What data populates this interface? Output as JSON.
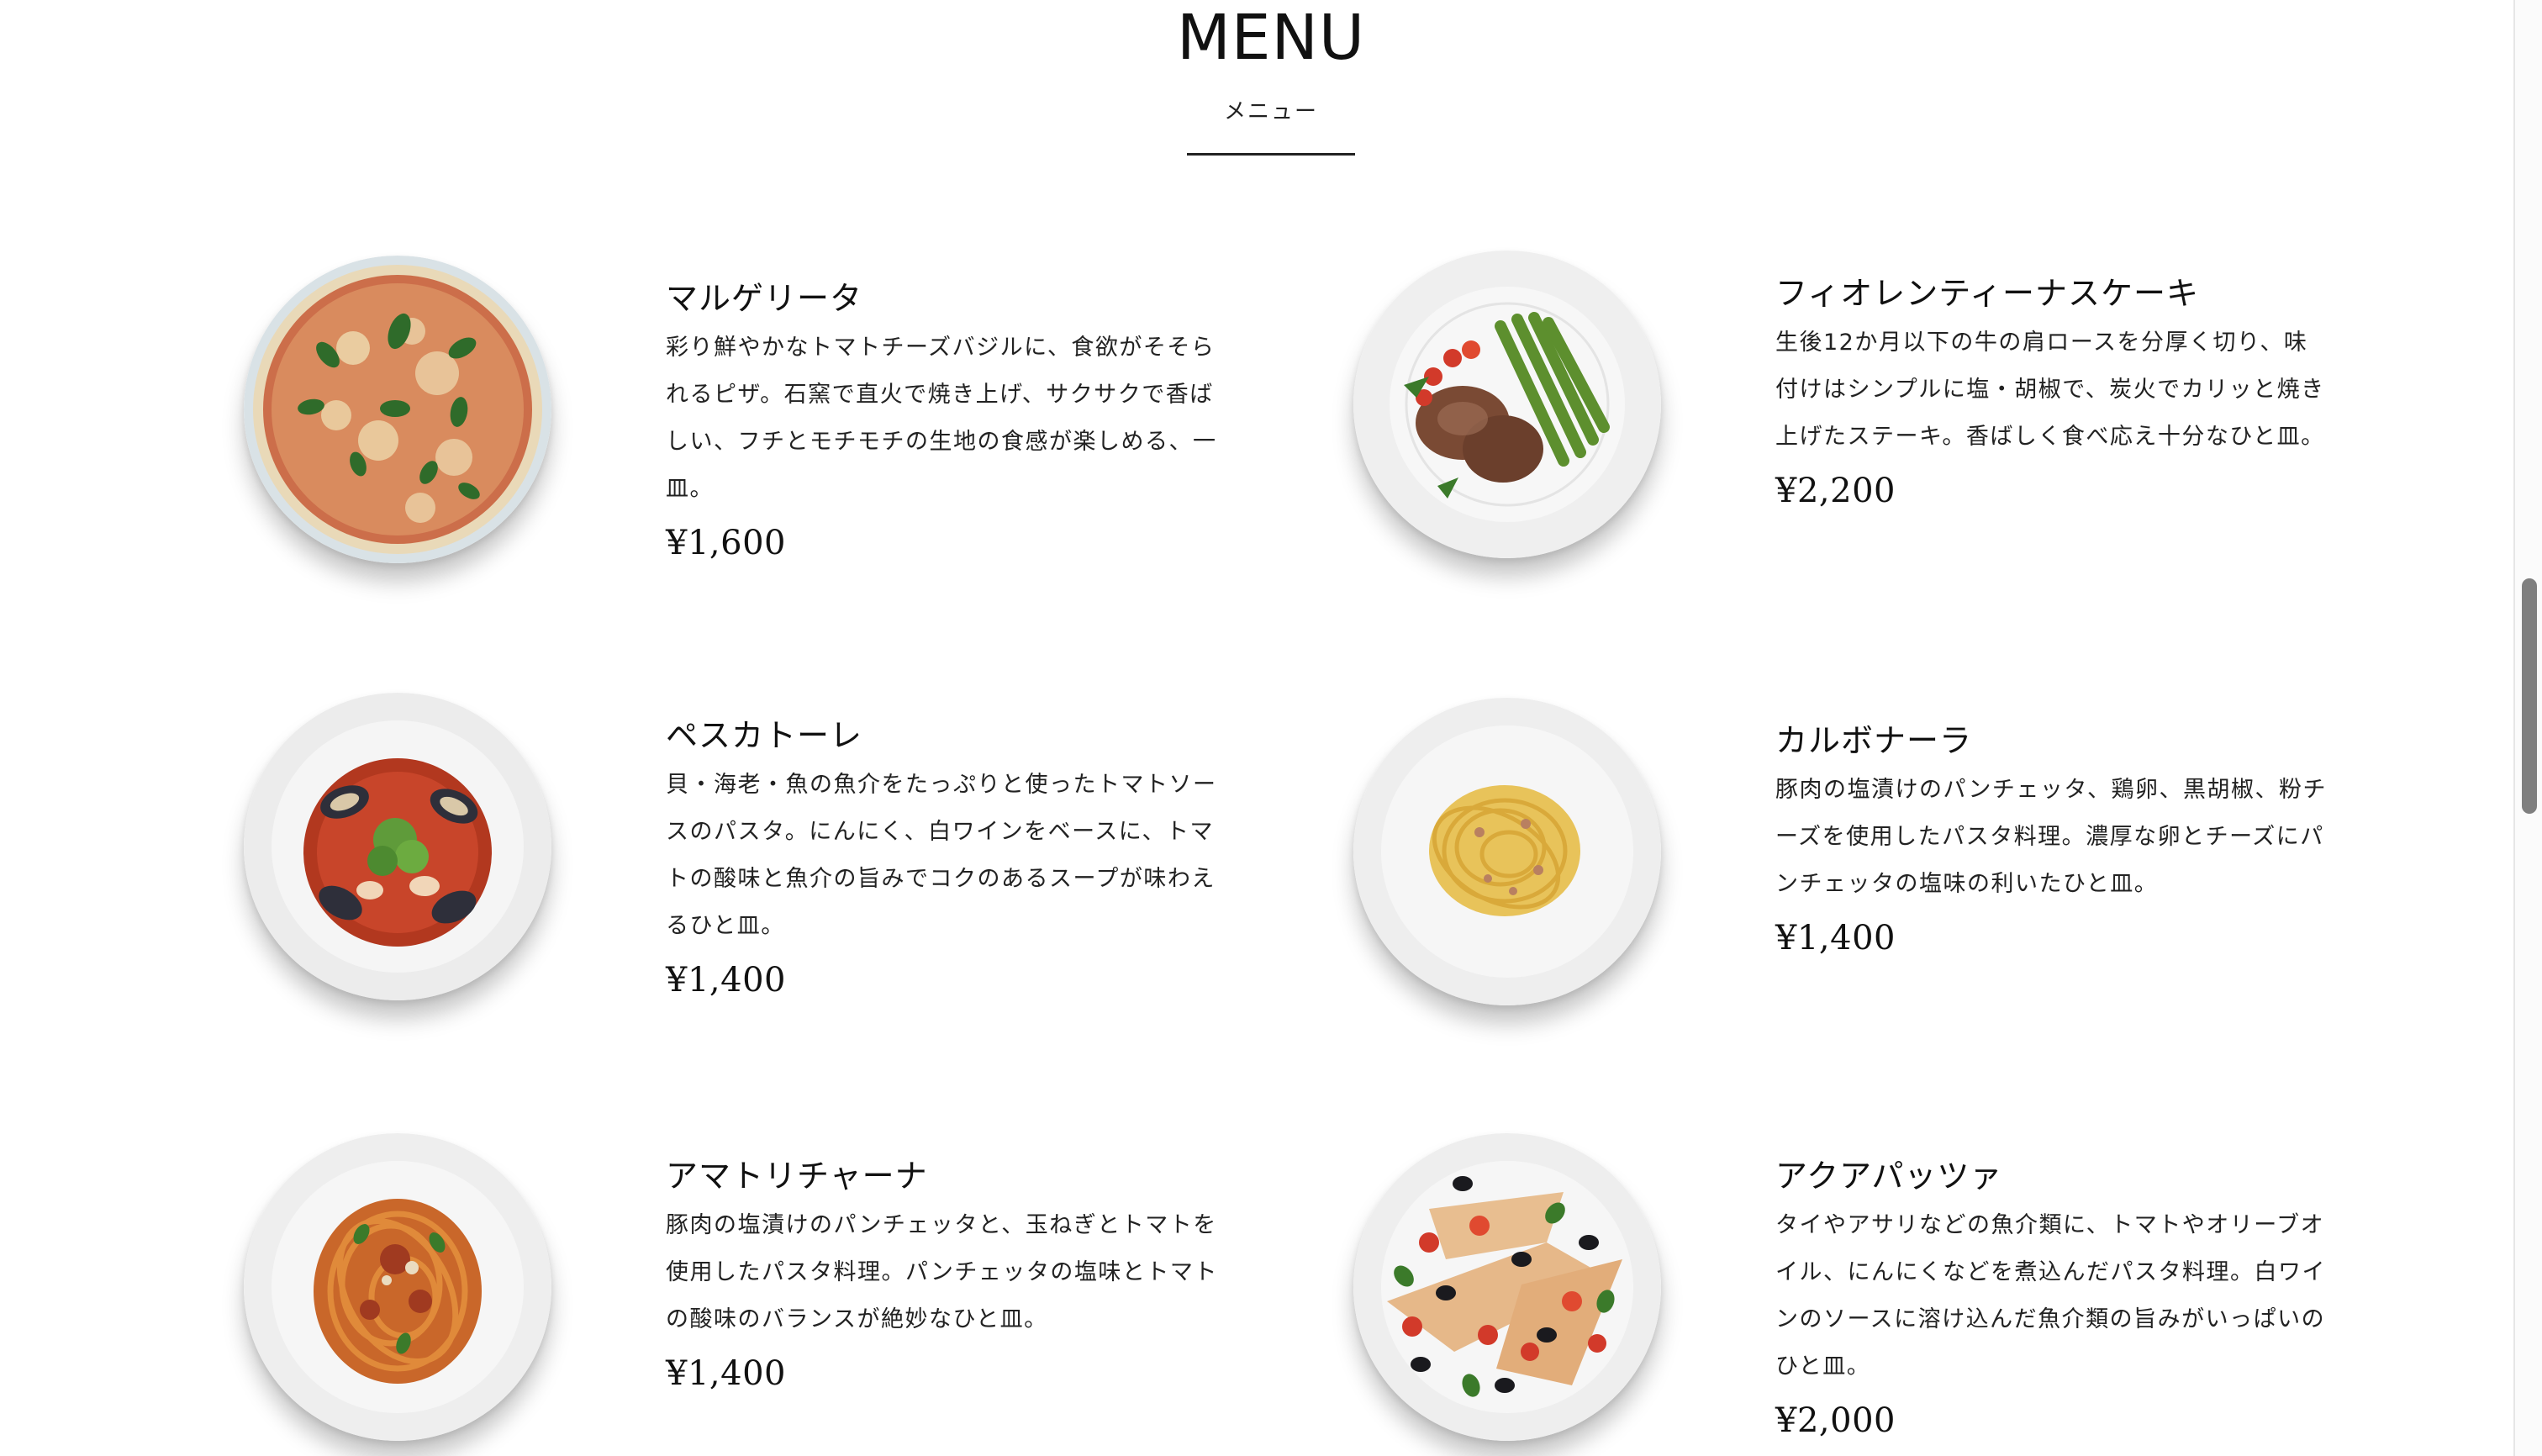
{
  "header": {
    "title": "MENU",
    "subtitle": "メニュー"
  },
  "items": [
    {
      "name": "マルゲリータ",
      "description": "彩り鮮やかなトマトチーズバジルに、食欲がそそられるピザ。石窯で直火で焼き上げ、サクサクで香ばしい、フチとモチモチの生地の食感が楽しめる、一皿。",
      "price": "¥1,600",
      "image": "margherita-pizza-photo"
    },
    {
      "name": "フィオレンティーナスケーキ",
      "description": "生後12か月以下の牛の肩ロースを分厚く切り、味付けはシンプルに塩・胡椒で、炭火でカリッと焼き上げたステーキ。香ばしく食べ応え十分なひと皿。",
      "price": "¥2,200",
      "image": "steak-with-asparagus-photo"
    },
    {
      "name": "ペスカトーレ",
      "description": "貝・海老・魚の魚介をたっぷりと使ったトマトソースのパスタ。にんにく、白ワインをベースに、トマトの酸味と魚介の旨みでコクのあるスープが味わえるひと皿。",
      "price": "¥1,400",
      "image": "pescatore-pasta-photo"
    },
    {
      "name": "カルボナーラ",
      "description": "豚肉の塩漬けのパンチェッタ、鶏卵、黒胡椒、粉チーズを使用したパスタ料理。濃厚な卵とチーズにパンチェッタの塩味の利いたひと皿。",
      "price": "¥1,400",
      "image": "carbonara-pasta-photo"
    },
    {
      "name": "アマトリチャーナ",
      "description": "豚肉の塩漬けのパンチェッタと、玉ねぎとトマトを使用したパスタ料理。パンチェッタの塩味とトマトの酸味のバランスが絶妙なひと皿。",
      "price": "¥1,400",
      "image": "amatriciana-pasta-photo"
    },
    {
      "name": "アクアパッツァ",
      "description": "タイやアサリなどの魚介類に、トマトやオリーブオイル、にんにくなどを煮込んだパスタ料理。白ワインのソースに溶け込んだ魚介類の旨みがいっぱいのひと皿。",
      "price": "¥2,000",
      "image": "acqua-pazza-fish-photo"
    }
  ],
  "colors": {
    "text": "#111111",
    "plate": "#f2f2f2",
    "tomato": "#c8321e",
    "basil": "#2f6b2a",
    "pasta": "#e8c35a"
  }
}
